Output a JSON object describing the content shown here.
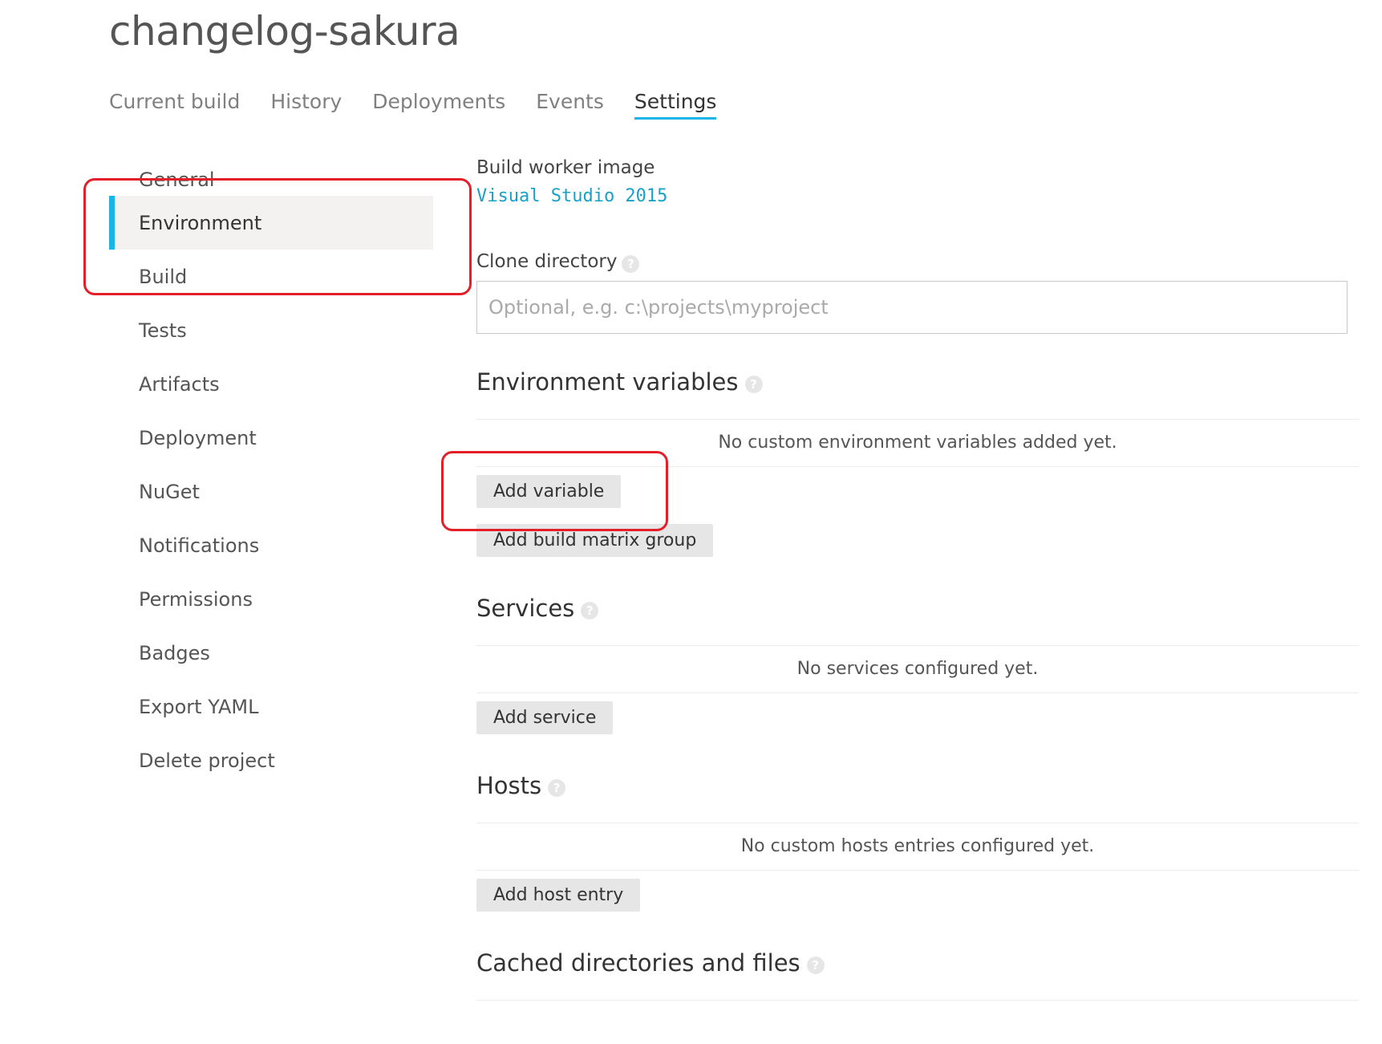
{
  "project": {
    "title": "changelog-sakura"
  },
  "tabs": [
    {
      "label": "Current build"
    },
    {
      "label": "History"
    },
    {
      "label": "Deployments"
    },
    {
      "label": "Events"
    },
    {
      "label": "Settings",
      "active": true
    }
  ],
  "sidebar": {
    "items": [
      {
        "label": "General"
      },
      {
        "label": "Environment",
        "active": true
      },
      {
        "label": "Build"
      },
      {
        "label": "Tests"
      },
      {
        "label": "Artifacts"
      },
      {
        "label": "Deployment"
      },
      {
        "label": "NuGet"
      },
      {
        "label": "Notifications"
      },
      {
        "label": "Permissions"
      },
      {
        "label": "Badges"
      },
      {
        "label": "Export YAML"
      },
      {
        "label": "Delete project"
      }
    ]
  },
  "main": {
    "build_worker_image": {
      "label": "Build worker image",
      "value": "Visual Studio 2015"
    },
    "clone_directory": {
      "label": "Clone directory",
      "value": "",
      "placeholder": "Optional, e.g. c:\\projects\\myproject"
    },
    "env_vars": {
      "title": "Environment variables",
      "empty_text": "No custom environment variables added yet.",
      "add_variable_label": "Add variable",
      "add_matrix_label": "Add build matrix group"
    },
    "services": {
      "title": "Services",
      "empty_text": "No services configured yet.",
      "add_label": "Add service"
    },
    "hosts": {
      "title": "Hosts",
      "empty_text": "No custom hosts entries configured yet.",
      "add_label": "Add host entry"
    },
    "cache": {
      "title": "Cached directories and files"
    }
  },
  "help_icon_glyph": "?",
  "colors": {
    "accent": "#1ab4e8",
    "annotation": "#e3202a",
    "button_bg": "#e6e6e6",
    "active_item_bg": "#f3f2f1"
  }
}
